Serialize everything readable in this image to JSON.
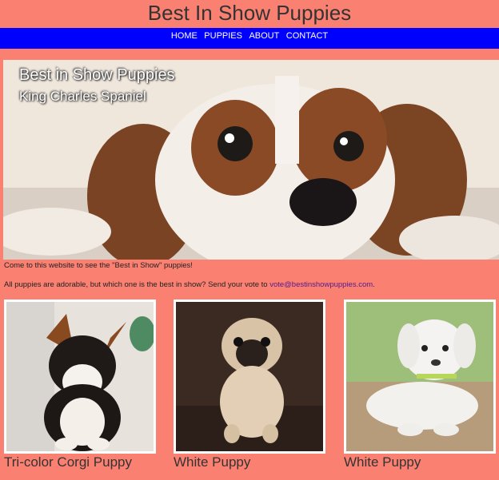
{
  "site": {
    "title": "Best In Show Puppies"
  },
  "nav": {
    "items": [
      "HOME",
      "PUPPIES",
      "ABOUT",
      "CONTACT"
    ]
  },
  "hero": {
    "title": "Best in Show Puppies",
    "subtitle": "King Charles Spaniel"
  },
  "intro": {
    "line1": "Come to this website to see the \"Best in Show\" puppies!",
    "line2": "All puppies are adorable, but which one is the best in show? Send your vote to",
    "email": "vote@bestinshowpuppies.com",
    "end": "."
  },
  "cards": [
    {
      "caption": "Tri-color Corgi Puppy"
    },
    {
      "caption": "White Puppy"
    },
    {
      "caption": "White Puppy"
    }
  ]
}
